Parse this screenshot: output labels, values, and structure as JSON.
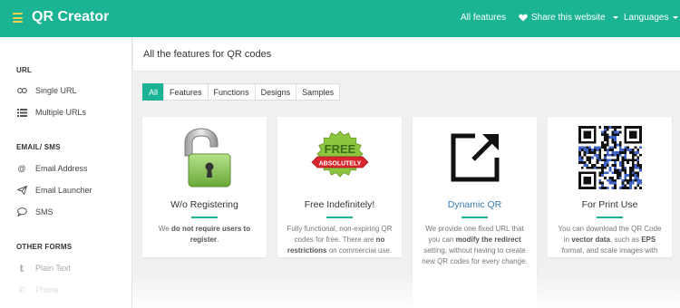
{
  "topbar": {
    "brand": "QR Creator",
    "features_link": "All features",
    "share_link": "Share this website",
    "languages_link": "Languages"
  },
  "sidebar": {
    "sections": [
      {
        "title": "URL",
        "items": [
          {
            "label": "Single URL",
            "icon": "link-icon"
          },
          {
            "label": "Multiple URLs",
            "icon": "list-icon"
          }
        ]
      },
      {
        "title": "EMAIL/ SMS",
        "items": [
          {
            "label": "Email Address",
            "icon": "at-icon"
          },
          {
            "label": "Email Launcher",
            "icon": "paper-plane-icon"
          },
          {
            "label": "SMS",
            "icon": "chat-bubble-icon"
          }
        ]
      },
      {
        "title": "OTHER FORMS",
        "items": [
          {
            "label": "Plain Text",
            "icon": "text-t-icon"
          },
          {
            "label": "Phone",
            "icon": "phone-icon"
          }
        ]
      }
    ]
  },
  "main": {
    "title": "All the features for QR codes",
    "tabs": [
      {
        "label": "All",
        "active": true
      },
      {
        "label": "Features",
        "active": false
      },
      {
        "label": "Functions",
        "active": false
      },
      {
        "label": "Designs",
        "active": false
      },
      {
        "label": "Samples",
        "active": false
      }
    ],
    "cards": [
      {
        "title": "W/o Registering",
        "icon": "padlock-open-icon",
        "desc_pre": "We ",
        "desc_bold": "do not require users to register",
        "desc_post": "."
      },
      {
        "title": "Free Indefinitely!",
        "icon": "free-badge-icon",
        "badge_top": "FREE",
        "badge_ribbon": "ABSOLUTELY",
        "desc_pre": "Fully functional, non-expiring QR codes for free. There are ",
        "desc_bold": "no restrictions",
        "desc_post": " on commercial use."
      },
      {
        "title": "Dynamic QR",
        "icon": "external-link-icon",
        "desc_pre": "We provide one fixed URL that you can ",
        "desc_bold": "modify the redirect",
        "desc_post": " setting, without having to create new QR codes for every change."
      },
      {
        "title": "For Print Use",
        "icon": "qr-code-icon",
        "desc_pre": "You can download the QR Code in ",
        "desc_bold": "vector data",
        "desc_mid": ", such as ",
        "desc_bold2": "EPS",
        "desc_post": " format, and scale images with high picture quality."
      }
    ]
  },
  "colors": {
    "brand_green": "#1ab394",
    "hamburger_yellow": "#f7d24a",
    "link_blue": "#3a7ab5",
    "badge_green": "#8cc63f",
    "ribbon_red": "#d7262e"
  }
}
